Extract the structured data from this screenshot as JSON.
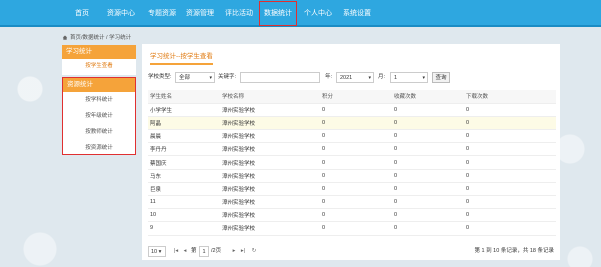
{
  "nav": {
    "items": [
      {
        "label": "首页"
      },
      {
        "label": "资源中心"
      },
      {
        "label": "专题资源"
      },
      {
        "label": "资源管理"
      },
      {
        "label": "评比活动"
      },
      {
        "label": "数据统计",
        "active": true
      },
      {
        "label": "个人中心"
      },
      {
        "label": "系统设置"
      }
    ]
  },
  "breadcrumb": {
    "text": "首页/数据统计 / 学习统计"
  },
  "sidebar": {
    "study": {
      "title": "学习统计",
      "sub": "按学生查看"
    },
    "resource": {
      "title": "资源统计",
      "items": [
        {
          "label": "按学科统计"
        },
        {
          "label": "按年级统计"
        },
        {
          "label": "按教师统计"
        },
        {
          "label": "按资源统计"
        }
      ]
    }
  },
  "main": {
    "tab": "学习统计--按学生查看",
    "filters": {
      "school_type_label": "学校类型:",
      "school_type_value": "全部",
      "keyword_label": "关键字:",
      "keyword_value": "",
      "year_label": "年:",
      "year_value": "2021",
      "month_label": "月:",
      "month_value": "1",
      "query_label": "查询"
    },
    "table": {
      "headers": [
        "学生姓名",
        "学校名称",
        "积分",
        "收藏次数",
        "下载次数"
      ],
      "rows": [
        [
          "小学学生",
          "漳州实验学校",
          "0",
          "0",
          "0"
        ],
        [
          "阿晶",
          "漳州实验学校",
          "0",
          "0",
          "0"
        ],
        [
          "晨晨",
          "漳州实验学校",
          "0",
          "0",
          "0"
        ],
        [
          "李丹丹",
          "漳州实验学校",
          "0",
          "0",
          "0"
        ],
        [
          "蔡国庆",
          "漳州实验学校",
          "0",
          "0",
          "0"
        ],
        [
          "马东",
          "漳州实验学校",
          "0",
          "0",
          "0"
        ],
        [
          "巨泉",
          "漳州实验学校",
          "0",
          "0",
          "0"
        ],
        [
          "11",
          "漳州实验学校",
          "0",
          "0",
          "0"
        ],
        [
          "10",
          "漳州实验学校",
          "0",
          "0",
          "0"
        ],
        [
          "9",
          "漳州实验学校",
          "0",
          "0",
          "0"
        ]
      ],
      "highlight_row": 1
    },
    "pager": {
      "page_size": "10",
      "page_prefix": "第",
      "page_value": "1",
      "page_suffix": "/2页",
      "summary": "第 1 到 10 条记录，共 18 条记录"
    }
  },
  "colors": {
    "nav_bg": "#2ea7e0",
    "accent": "#f5a33a",
    "active_outline": "#e03030"
  }
}
